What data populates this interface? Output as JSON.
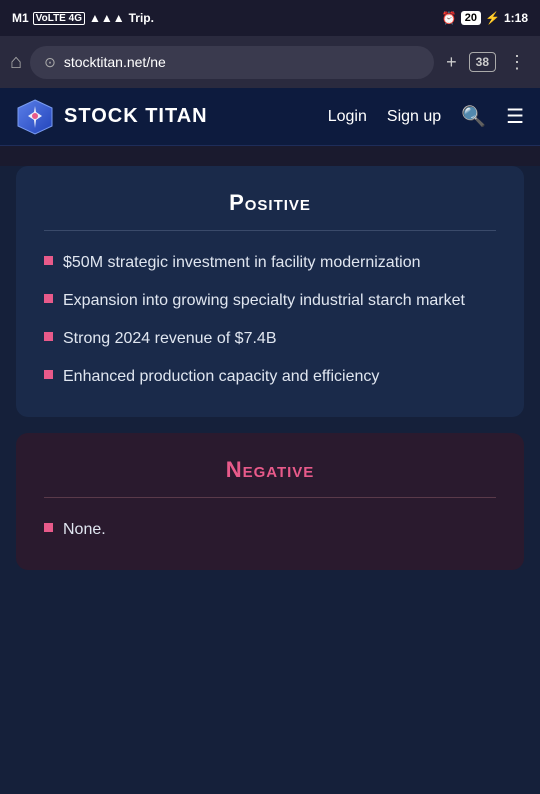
{
  "statusBar": {
    "carrier": "M1",
    "network": "VoLTE 4G",
    "signal": "▲▲▲",
    "wifi": "Trip.",
    "alarm": "⏰",
    "battery": "20",
    "charging": "⚡",
    "time": "1:18"
  },
  "browser": {
    "addressText": "stocktitan.net/ne",
    "tabsCount": "38",
    "homeLabel": "⌂",
    "newTabLabel": "+",
    "menuLabel": "⋮"
  },
  "navbar": {
    "brandName": "STOCK TITAN",
    "loginLabel": "Login",
    "signupLabel": "Sign up"
  },
  "positive": {
    "title": "Positive",
    "items": [
      "$50M strategic investment in facility modernization",
      "Expansion into growing specialty industrial starch market",
      "Strong 2024 revenue of $7.4B",
      "Enhanced production capacity and efficiency"
    ]
  },
  "negative": {
    "title": "Negative",
    "items": [
      "None."
    ]
  }
}
